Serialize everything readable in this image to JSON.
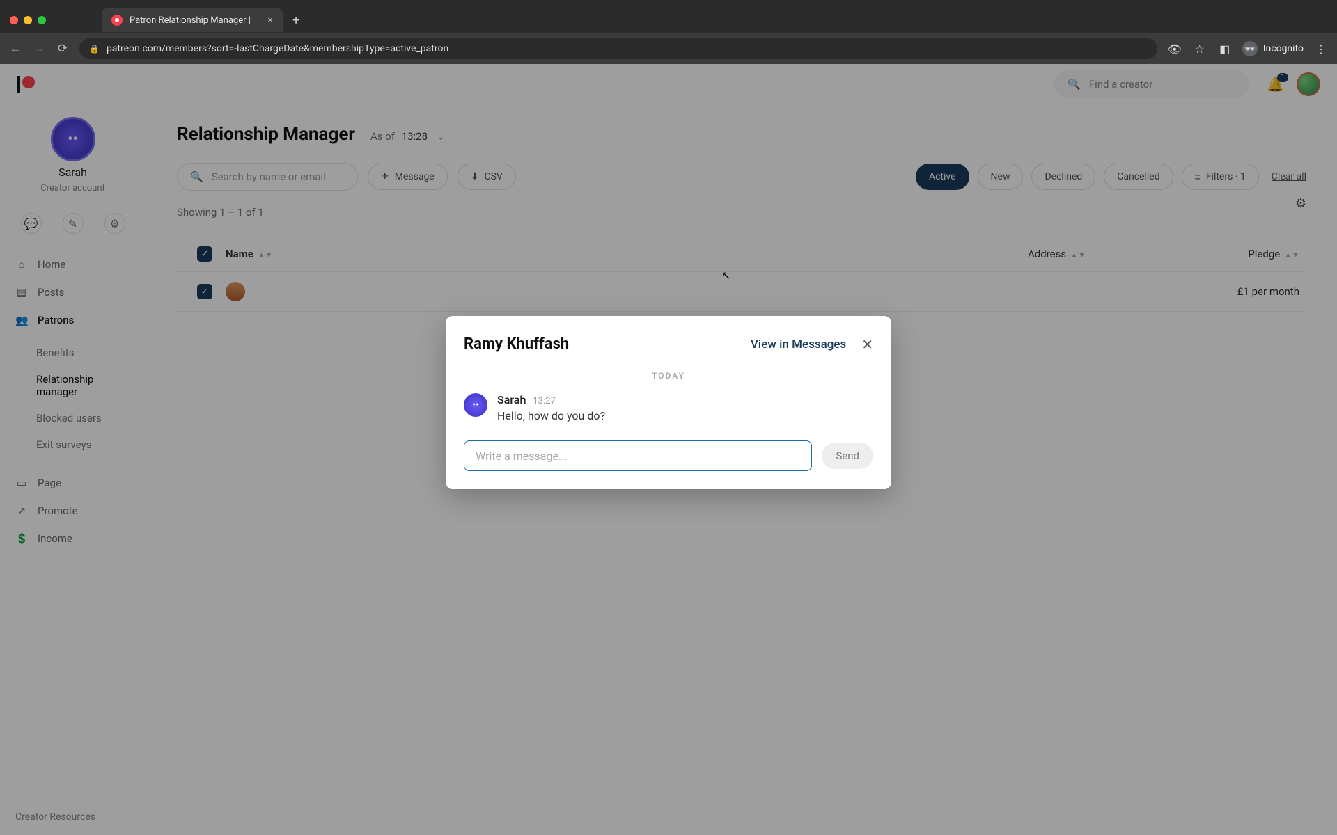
{
  "browser": {
    "tab_title": "Patron Relationship Manager |",
    "url": "patreon.com/members?sort=-lastChargeDate&membershipType=active_patron",
    "incognito_label": "Incognito",
    "new_tab_icon": "+"
  },
  "header": {
    "search_placeholder": "Find a creator",
    "notification_count": "1"
  },
  "sidebar": {
    "creator_name": "Sarah",
    "creator_subtitle": "Creator account",
    "nav": {
      "home": "Home",
      "posts": "Posts",
      "patrons": "Patrons",
      "page": "Page",
      "promote": "Promote",
      "income": "Income"
    },
    "subnav": {
      "benefits": "Benefits",
      "relmgr": "Relationship manager",
      "blocked": "Blocked users",
      "exit": "Exit surveys"
    },
    "footer": "Creator Resources"
  },
  "main": {
    "title": "Relationship Manager",
    "asof_label": "As of",
    "asof_time": "13:28",
    "search_placeholder": "Search by name or email",
    "btn_message": "Message",
    "btn_csv": "CSV",
    "filters": {
      "active": "Active",
      "new": "New",
      "declined": "Declined",
      "cancelled": "Cancelled",
      "filters": "Filters · 1"
    },
    "clear_all": "Clear all",
    "result_count": "Showing 1 – 1 of 1",
    "columns": {
      "name": "Name",
      "address": "Address",
      "pledge": "Pledge"
    },
    "row": {
      "pledge": "£1 per month"
    }
  },
  "modal": {
    "title": "Ramy Khuffash",
    "view": "View in Messages",
    "day": "TODAY",
    "msg_name": "Sarah",
    "msg_time": "13:27",
    "msg_body": "Hello, how do you do?",
    "compose_placeholder": "Write a message...",
    "send": "Send"
  }
}
